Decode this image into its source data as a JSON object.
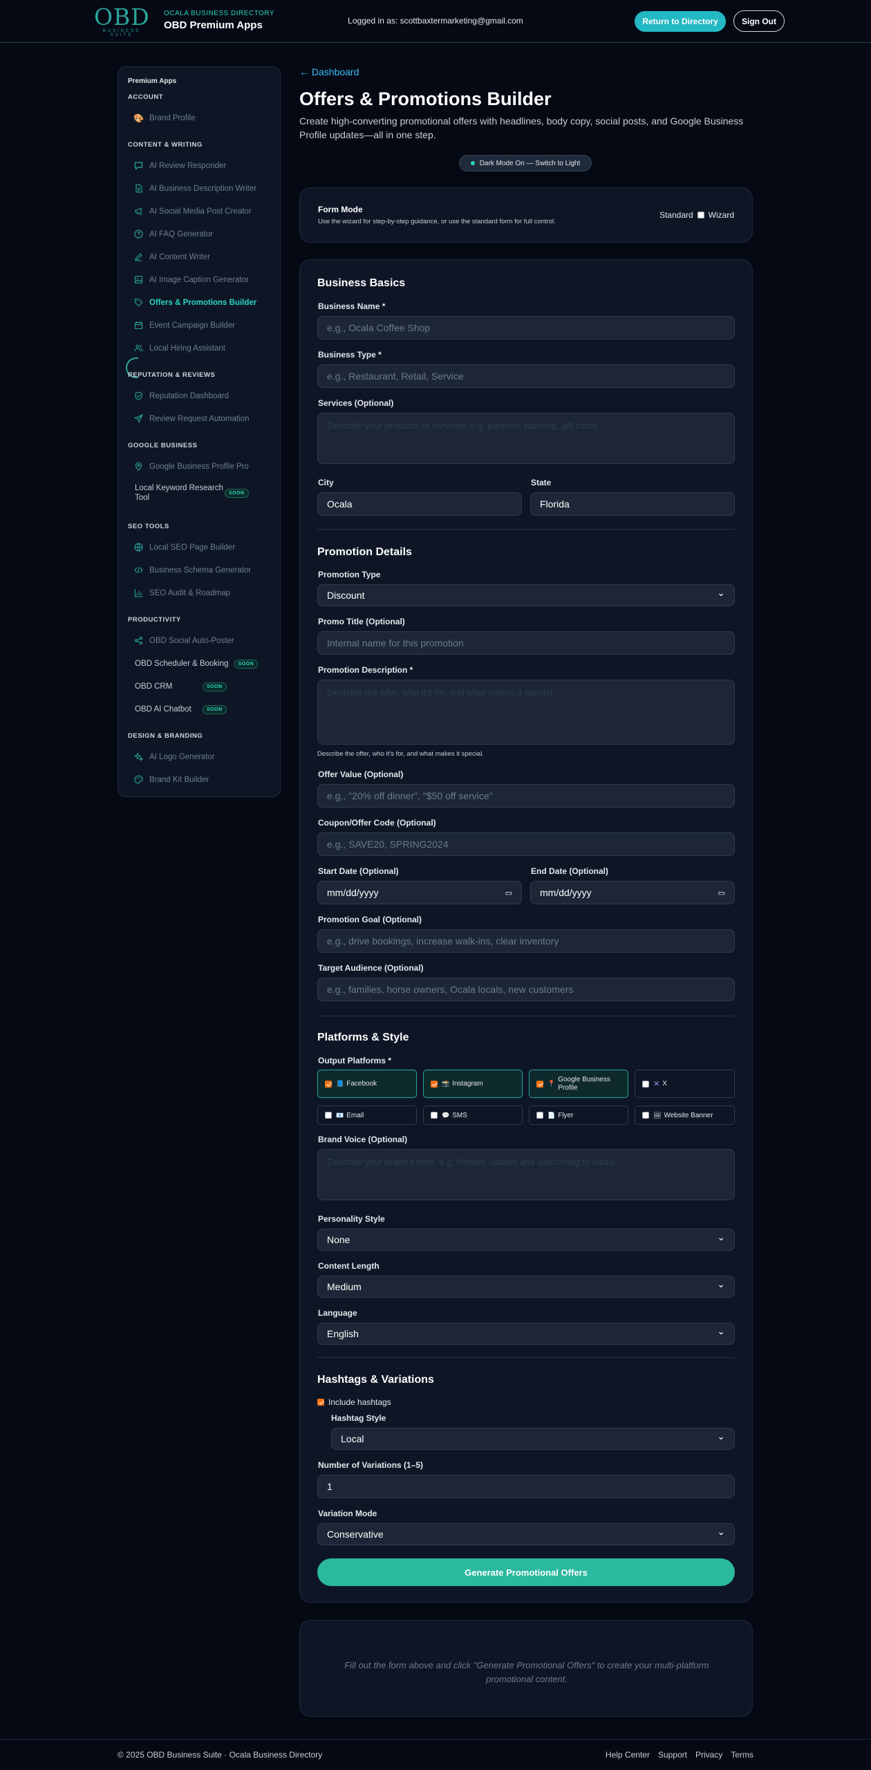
{
  "header": {
    "logo_text": "OBD",
    "logo_sub": "BUSINESS SUITE",
    "brand_sub": "OCALA BUSINESS DIRECTORY",
    "brand_title": "OBD Premium Apps",
    "login_text": "Logged in as: scottbaxtermarketing@gmail.com",
    "return_label": "Return to Directory",
    "signout_label": "Sign Out"
  },
  "sidebar": {
    "title": "Premium Apps",
    "sections": {
      "account": "ACCOUNT",
      "content": "CONTENT & WRITING",
      "reputation": "REPUTATION & REVIEWS",
      "google": "GOOGLE BUSINESS",
      "seo": "SEO TOOLS",
      "productivity": "PRODUCTIVITY",
      "design": "DESIGN & BRANDING"
    },
    "items": {
      "brand_profile": "Brand Profile",
      "review_responder": "AI Review Responder",
      "business_description": "AI Business Description Writer",
      "social_post": "AI Social Media Post Creator",
      "faq": "AI FAQ Generator",
      "content_writer": "AI Content Writer",
      "image_caption": "AI Image Caption Generator",
      "offers": "Offers & Promotions Builder",
      "event_campaign": "Event Campaign Builder",
      "hiring": "Local Hiring Assistant",
      "rep_dashboard": "Reputation Dashboard",
      "review_request": "Review Request Automation",
      "gbp_pro": "Google Business Profile Pro",
      "keyword_research": "Local Keyword Research Tool",
      "seo_page": "Local SEO Page Builder",
      "schema": "Business Schema Generator",
      "seo_audit": "SEO Audit & Roadmap",
      "auto_poster": "OBD Social Auto-Poster",
      "scheduler": "OBD Scheduler & Booking",
      "crm": "OBD CRM",
      "chatbot": "OBD AI Chatbot",
      "logo_gen": "AI Logo Generator",
      "brand_kit": "Brand Kit Builder"
    },
    "soon_label": "SOON"
  },
  "page": {
    "back_link": "← Dashboard",
    "title": "Offers & Promotions Builder",
    "description": "Create high-converting promotional offers with headlines, body copy, social posts, and Google Business Profile updates—all in one step.",
    "dark_mode_label": "Dark Mode On — Switch to Light"
  },
  "form_mode": {
    "title": "Form Mode",
    "description": "Use the wizard for step-by-step guidance, or use the standard form for full control.",
    "standard_label": "Standard",
    "wizard_label": "Wizard"
  },
  "basics": {
    "heading": "Business Basics",
    "name_label": "Business Name *",
    "name_placeholder": "e.g., Ocala Coffee Shop",
    "type_label": "Business Type *",
    "type_placeholder": "e.g., Restaurant, Retail, Service",
    "services_label": "Services (Optional)",
    "services_placeholder": "Describe your products or services, e.g. pastries, catering, gift cards",
    "city_label": "City",
    "city_value": "Ocala",
    "state_label": "State",
    "state_value": "Florida"
  },
  "promotion": {
    "heading": "Promotion Details",
    "type_label": "Promotion Type",
    "type_value": "Discount",
    "title_label": "Promo Title (Optional)",
    "title_placeholder": "Internal name for this promotion",
    "desc_label": "Promotion Description *",
    "desc_placeholder": "Describe the offer, who it's for, and what makes it special",
    "desc_hint": "Describe the offer, who it's for, and what makes it special.",
    "offer_label": "Offer Value (Optional)",
    "offer_placeholder": "e.g., \"20% off dinner\", \"$50 off service\"",
    "coupon_label": "Coupon/Offer Code (Optional)",
    "coupon_placeholder": "e.g., SAVE20, SPRING2024",
    "start_label": "Start Date (Optional)",
    "end_label": "End Date (Optional)",
    "date_placeholder": "mm/dd/yyyy",
    "goal_label": "Promotion Goal (Optional)",
    "goal_placeholder": "e.g., drive bookings, increase walk-ins, clear inventory",
    "audience_label": "Target Audience (Optional)",
    "audience_placeholder": "e.g., families, horse owners, Ocala locals, new customers"
  },
  "platforms": {
    "heading": "Platforms & Style",
    "output_label": "Output Platforms *",
    "items": [
      {
        "label": "Facebook",
        "icon": "📘",
        "checked": true
      },
      {
        "label": "Instagram",
        "icon": "📸",
        "checked": true
      },
      {
        "label": "Google Business Profile",
        "icon": "📍",
        "checked": true
      },
      {
        "label": "X",
        "icon": "✕",
        "checked": false
      },
      {
        "label": "Email",
        "icon": "📧",
        "checked": false
      },
      {
        "label": "SMS",
        "icon": "💬",
        "checked": false
      },
      {
        "label": "Flyer",
        "icon": "📄",
        "checked": false
      },
      {
        "label": "Website Banner",
        "icon": "🖼",
        "checked": false
      }
    ],
    "voice_label": "Brand Voice (Optional)",
    "voice_placeholder": "Describe your brand's tone, e.g. friendly, upbeat and welcoming to locals",
    "personality_label": "Personality Style",
    "personality_value": "None",
    "length_label": "Content Length",
    "length_value": "Medium",
    "language_label": "Language",
    "language_value": "English"
  },
  "hashtags": {
    "heading": "Hashtags & Variations",
    "include_label": "Include hashtags",
    "style_label": "Hashtag Style",
    "style_value": "Local",
    "variations_label": "Number of Variations (1–5)",
    "variations_value": "1",
    "mode_label": "Variation Mode",
    "mode_value": "Conservative"
  },
  "generate_label": "Generate Promotional Offers",
  "result_text": "Fill out the form above and click \"Generate Promotional Offers\" to create your multi-platform promotional content.",
  "footer": {
    "copyright": "© 2025 OBD Business Suite · Ocala Business Directory",
    "links": [
      "Help Center",
      "Support",
      "Privacy",
      "Terms"
    ]
  },
  "colors": {
    "accent": "#2dd4bf",
    "button": "#22b8c4",
    "generate": "#2ab89f",
    "background": "#050914",
    "card": "#0e1626"
  }
}
